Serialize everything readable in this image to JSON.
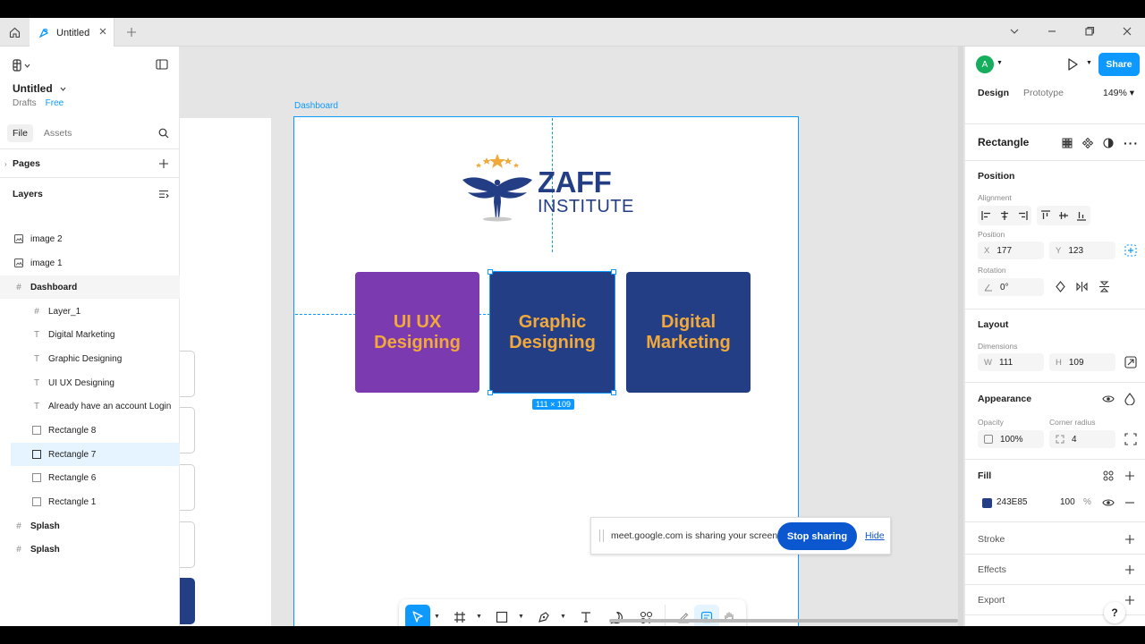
{
  "tabbar": {
    "tab_title": "Untitled"
  },
  "left": {
    "file_title": "Untitled",
    "drafts_label": "Drafts",
    "plan_label": "Free",
    "tabs": [
      {
        "label": "File"
      },
      {
        "label": "Assets"
      }
    ],
    "pages_label": "Pages",
    "layers_label": "Layers",
    "layers": [
      {
        "name": "image 2",
        "icon": "image-icon"
      },
      {
        "name": "image 1",
        "icon": "image-icon"
      },
      {
        "name": "Dashboard",
        "icon": "frame-icon"
      },
      {
        "name": "Layer_1",
        "icon": "frame-icon"
      },
      {
        "name": "Digital Marketing",
        "icon": "text-icon"
      },
      {
        "name": "Graphic Designing",
        "icon": "text-icon"
      },
      {
        "name": "UI UX Designing",
        "icon": "text-icon"
      },
      {
        "name": "Already have an account Login",
        "icon": "text-icon"
      },
      {
        "name": "Rectangle 8",
        "icon": "rectangle-icon"
      },
      {
        "name": "Rectangle 7",
        "icon": "rectangle-icon"
      },
      {
        "name": "Rectangle 6",
        "icon": "rectangle-icon"
      },
      {
        "name": "Rectangle 1",
        "icon": "rectangle-icon"
      },
      {
        "name": "Splash",
        "icon": "frame-icon"
      },
      {
        "name": "Splash",
        "icon": "frame-icon"
      }
    ]
  },
  "canvas": {
    "frame_label": "Dashboard",
    "logo_line1": "ZAFF",
    "logo_line2": "INSTITUTE",
    "cards": [
      {
        "line1": "UI UX",
        "line2": "Designing",
        "color": "#7B3AB0"
      },
      {
        "line1": "Graphic",
        "line2": "Designing",
        "color": "#243E85"
      },
      {
        "line1": "Digital",
        "line2": "Marketing",
        "color": "#243E85"
      }
    ],
    "dimension_badge": "111 × 109",
    "accent": "#F2A93B"
  },
  "sharing": {
    "message": "meet.google.com is sharing your screen.",
    "stop_label": "Stop sharing",
    "hide_label": "Hide"
  },
  "right": {
    "avatar_initial": "A",
    "share_label": "Share",
    "tabs": [
      {
        "label": "Design"
      },
      {
        "label": "Prototype"
      }
    ],
    "zoom": "149%",
    "selection_name": "Rectangle",
    "position_title": "Position",
    "alignment_label": "Alignment",
    "position_label": "Position",
    "x_label": "X",
    "x_value": "177",
    "y_label": "Y",
    "y_value": "123",
    "rotation_label": "Rotation",
    "rotation_value": "0°",
    "layout_title": "Layout",
    "dimensions_label": "Dimensions",
    "w_label": "W",
    "w_value": "111",
    "h_label": "H",
    "h_value": "109",
    "appearance_title": "Appearance",
    "opacity_label": "Opacity",
    "opacity_value": "100%",
    "radius_label": "Corner radius",
    "radius_value": "4",
    "fill_title": "Fill",
    "fill_hex": "243E85",
    "fill_opacity": "100",
    "fill_pct": "%",
    "fill_color": "#243E85",
    "stroke_title": "Stroke",
    "effects_title": "Effects",
    "export_title": "Export",
    "help_label": "?"
  },
  "colors": {
    "brand_blue": "#0d99ff"
  }
}
